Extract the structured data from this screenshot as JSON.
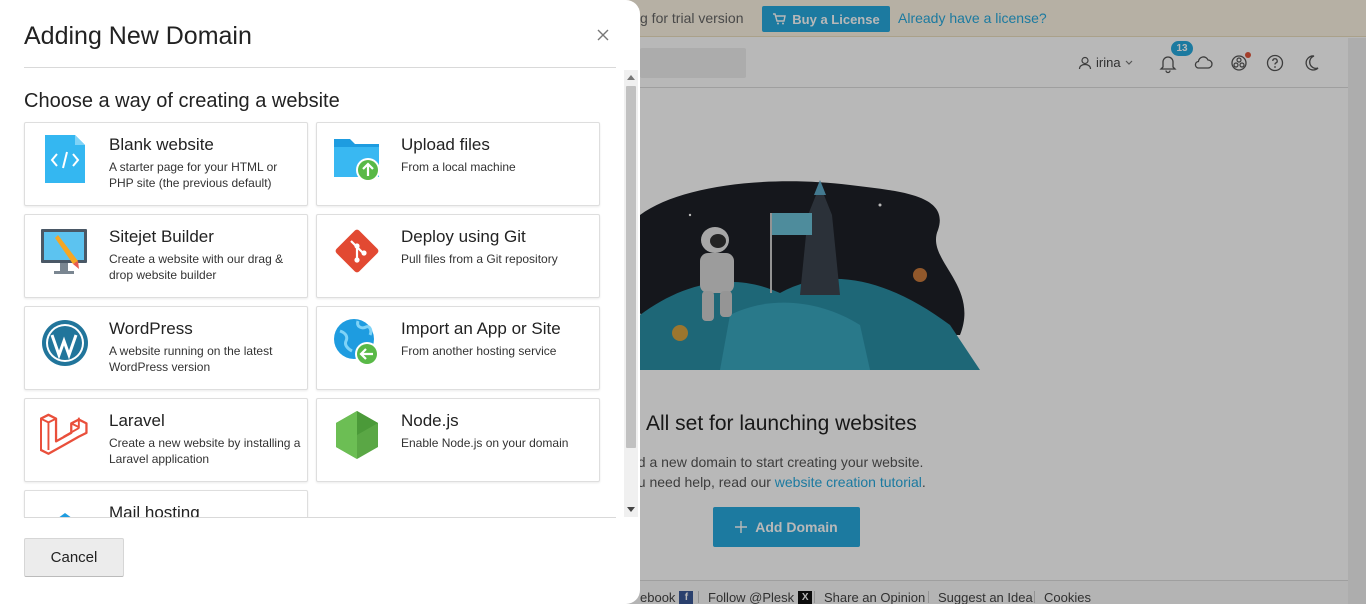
{
  "background": {
    "trial_text": "g for trial version",
    "buy_license": "Buy a License",
    "already_license": "Already have a license?",
    "user_name": "irina",
    "notifications_count": "13",
    "empty_title": "All set for launching websites",
    "empty_line1": "dd a new domain to start creating your website.",
    "empty_line2_prefix": "ou need help, read our ",
    "empty_line2_link": "website creation tutorial",
    "empty_line2_suffix": ".",
    "add_domain": "Add Domain",
    "footer": {
      "facebook": "ebook",
      "follow": "Follow @Plesk",
      "share": "Share an Opinion",
      "suggest": "Suggest an Idea",
      "cookies": "Cookies"
    }
  },
  "dialog": {
    "title": "Adding New Domain",
    "section_title": "Choose a way of creating a website",
    "cancel_label": "Cancel",
    "cards": [
      {
        "title": "Blank website",
        "desc": "A starter page for your HTML or PHP site (the previous default)",
        "icon": "code-file-icon"
      },
      {
        "title": "Upload files",
        "desc": "From a local machine",
        "icon": "folder-upload-icon"
      },
      {
        "title": "Sitejet Builder",
        "desc": "Create a website with our drag & drop website builder",
        "icon": "monitor-pencil-icon"
      },
      {
        "title": "Deploy using Git",
        "desc": "Pull files from a Git repository",
        "icon": "git-icon"
      },
      {
        "title": "WordPress",
        "desc": "A website running on the latest WordPress version",
        "icon": "wordpress-icon"
      },
      {
        "title": "Import an App or Site",
        "desc": "From another hosting service",
        "icon": "globe-import-icon"
      },
      {
        "title": "Laravel",
        "desc": "Create a new website by installing a Laravel application",
        "icon": "laravel-icon"
      },
      {
        "title": "Node.js",
        "desc": "Enable Node.js on your domain",
        "icon": "nodejs-icon"
      },
      {
        "title": "Mail hosting",
        "desc": "",
        "icon": "mail-icon"
      }
    ]
  },
  "colors": {
    "accent": "#28aade",
    "overlay": "rgba(0,0,0,0.28)",
    "git": "#e24932",
    "laravel": "#e94f3b",
    "nodejs": "#5aa745",
    "wordpress": "#21759b"
  }
}
